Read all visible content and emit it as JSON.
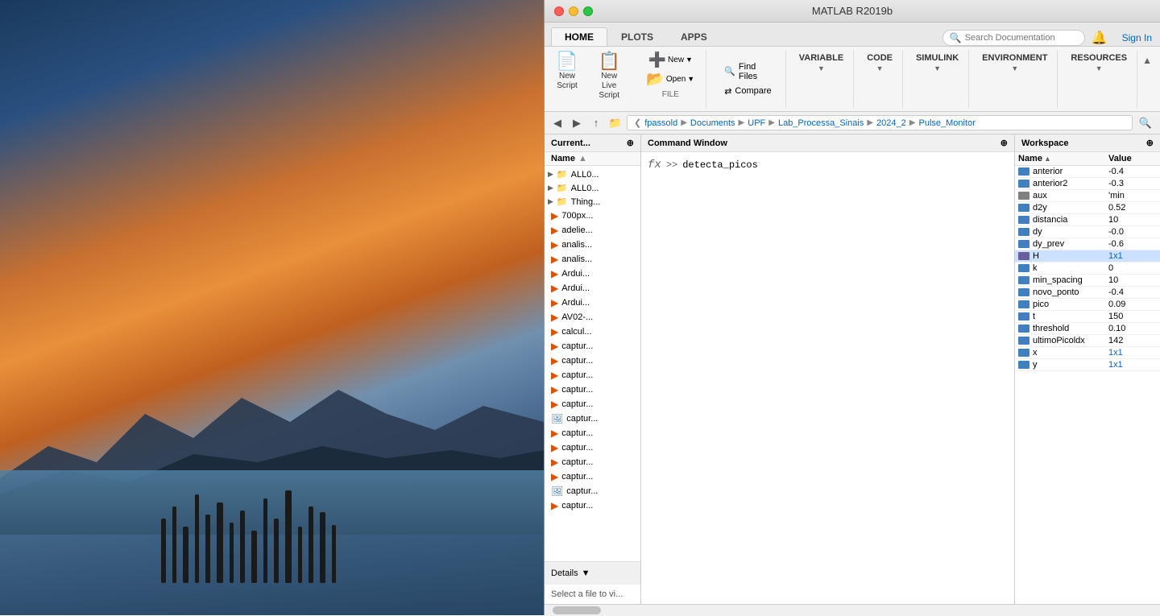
{
  "window": {
    "title": "MATLAB R2019b"
  },
  "tabs": [
    {
      "id": "home",
      "label": "HOME",
      "active": true
    },
    {
      "id": "plots",
      "label": "PLOTS",
      "active": false
    },
    {
      "id": "apps",
      "label": "APPS",
      "active": false
    }
  ],
  "ribbon": {
    "new_script_label": "New\nScript",
    "new_live_script_label": "New\nLive Script",
    "new_label": "New",
    "open_label": "Open",
    "find_files_label": "Find Files",
    "compare_label": "Compare",
    "file_group_label": "FILE",
    "variable_label": "VARIABLE",
    "code_label": "CODE",
    "simulink_label": "SIMULINK",
    "environment_label": "ENVIRONMENT",
    "resources_label": "RESOURCES",
    "search_placeholder": "Search Documentation",
    "sign_in_label": "Sign In"
  },
  "address_bar": {
    "path_parts": [
      "fpassold",
      "Documents",
      "UPF",
      "Lab_Processa_Sinais",
      "2024_2",
      "Pulse_Monitor"
    ]
  },
  "file_browser": {
    "header": "Current...",
    "column_name": "Name",
    "sort_arrow": "▲",
    "items": [
      {
        "type": "folder",
        "name": "ALL0...",
        "expanded": true
      },
      {
        "type": "folder",
        "name": "ALL0...",
        "expanded": true
      },
      {
        "type": "folder",
        "name": "Thing...",
        "expanded": true
      },
      {
        "type": "file",
        "name": "700px...",
        "ext": "m"
      },
      {
        "type": "file",
        "name": "adelie...",
        "ext": "m"
      },
      {
        "type": "file",
        "name": "analis...",
        "ext": "m"
      },
      {
        "type": "file",
        "name": "analis...",
        "ext": "m"
      },
      {
        "type": "file",
        "name": "Ardui...",
        "ext": "m"
      },
      {
        "type": "file",
        "name": "Ardui...",
        "ext": "m"
      },
      {
        "type": "file",
        "name": "Ardui...",
        "ext": "m"
      },
      {
        "type": "file",
        "name": "AV02-...",
        "ext": "m"
      },
      {
        "type": "file",
        "name": "calcul...",
        "ext": "m"
      },
      {
        "type": "file",
        "name": "captur...",
        "ext": "m"
      },
      {
        "type": "file",
        "name": "captur...",
        "ext": "m"
      },
      {
        "type": "file",
        "name": "captur...",
        "ext": "m"
      },
      {
        "type": "file",
        "name": "captur...",
        "ext": "m"
      },
      {
        "type": "file",
        "name": "captur...",
        "ext": "m"
      },
      {
        "type": "file",
        "name": "captur...",
        "ext": "img"
      },
      {
        "type": "file",
        "name": "captur...",
        "ext": "m"
      },
      {
        "type": "file",
        "name": "captur...",
        "ext": "m"
      },
      {
        "type": "file",
        "name": "captur...",
        "ext": "m"
      },
      {
        "type": "file",
        "name": "captur...",
        "ext": "m"
      },
      {
        "type": "file",
        "name": "captur...",
        "ext": "img"
      },
      {
        "type": "file",
        "name": "captur...",
        "ext": "m"
      }
    ],
    "details_label": "Details",
    "details_content": "Select a file to vi..."
  },
  "command_window": {
    "header": "Command Window",
    "fx_symbol": "fx",
    "prompt_symbol": ">>",
    "command_text": "detecta_picos"
  },
  "workspace": {
    "header": "Workspace",
    "col_name": "Name",
    "col_sort": "▲",
    "col_value": "Value",
    "variables": [
      {
        "name": "anterior",
        "value": "-0.4",
        "type": "num",
        "link": false
      },
      {
        "name": "anterior2",
        "value": "-0.3",
        "type": "num",
        "link": false
      },
      {
        "name": "aux",
        "value": "'min",
        "type": "str",
        "link": false
      },
      {
        "name": "d2y",
        "value": "0.52",
        "type": "num",
        "link": false
      },
      {
        "name": "distancia",
        "value": "10",
        "type": "num",
        "link": false
      },
      {
        "name": "dy",
        "value": "-0.0",
        "type": "num",
        "link": false
      },
      {
        "name": "dy_prev",
        "value": "-0.6",
        "type": "num",
        "link": false
      },
      {
        "name": "H",
        "value": "1x1",
        "type": "matrix",
        "link": true
      },
      {
        "name": "k",
        "value": "0",
        "type": "num",
        "link": false
      },
      {
        "name": "min_spacing",
        "value": "10",
        "type": "num",
        "link": false
      },
      {
        "name": "novo_ponto",
        "value": "-0.4",
        "type": "num",
        "link": false
      },
      {
        "name": "pico",
        "value": "0.09",
        "type": "num",
        "link": false
      },
      {
        "name": "t",
        "value": "150",
        "type": "num",
        "link": false
      },
      {
        "name": "threshold",
        "value": "0.10",
        "type": "num",
        "link": false
      },
      {
        "name": "ultimoPicoldx",
        "value": "142",
        "type": "num",
        "link": false
      },
      {
        "name": "x",
        "value": "1x1",
        "type": "matrix",
        "link": true
      },
      {
        "name": "y",
        "value": "1x1",
        "type": "matrix",
        "link": true
      }
    ]
  }
}
